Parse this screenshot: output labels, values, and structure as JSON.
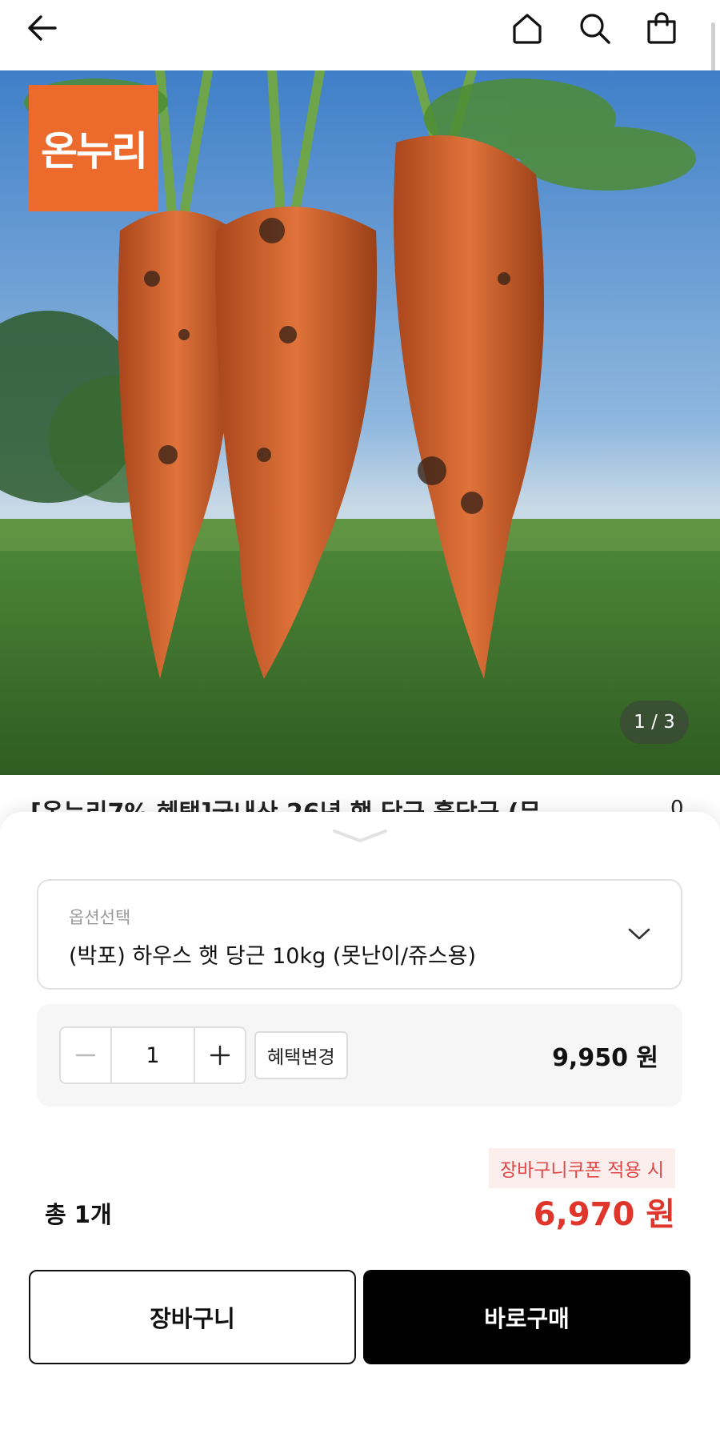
{
  "header": {
    "icons": [
      "back-arrow-icon",
      "home-icon",
      "search-icon",
      "shopping-bag-icon"
    ]
  },
  "hero": {
    "brand_badge": "온누리",
    "page_indicator": "1 / 3",
    "current_page": 1,
    "total_pages": 3
  },
  "product": {
    "title_peek": "[온누리7% 혜택]국내산 26년 햇 당근 흙당근 (무",
    "title_side": "0"
  },
  "option": {
    "label": "옵션선택",
    "selected": "(박포) 하우스 햇 당근 10kg (못난이/쥬스용)"
  },
  "quantity": {
    "value": "1",
    "benefit_button": "혜택변경",
    "price": "9,950 원"
  },
  "summary": {
    "coupon_note": "장바구니쿠폰 적용 시",
    "total_label": "총 1개",
    "total_price": "6,970 원"
  },
  "actions": {
    "cart": "장바구니",
    "buy_now": "바로구매"
  },
  "colors": {
    "brand_orange": "#ec6a2c",
    "price_red": "#e0352b",
    "coupon_bg": "#fdeeee"
  }
}
